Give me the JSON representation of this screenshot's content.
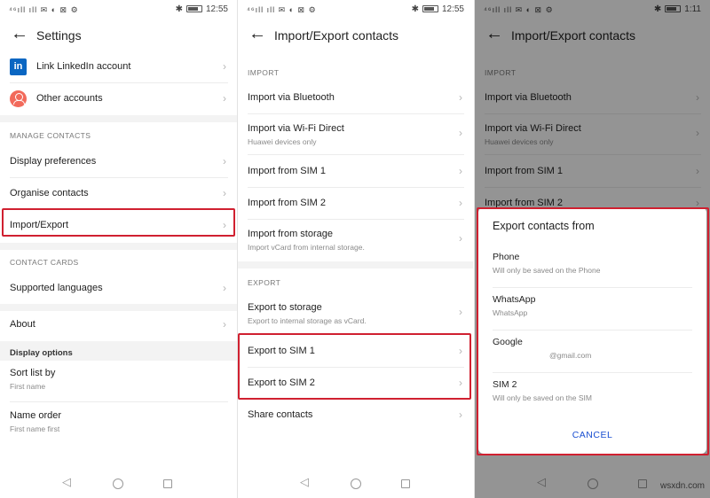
{
  "status": {
    "left_icons": "⁴⁶ıll ıll ✉ ◐ ⊠ ⚙",
    "time_left": "12:55",
    "time_middle": "12:55",
    "time_right": "1:11"
  },
  "screen1": {
    "title": "Settings",
    "accounts": [
      {
        "label": "Link LinkedIn account",
        "icon": "linkedin-icon"
      },
      {
        "label": "Other accounts",
        "icon": "account-icon"
      }
    ],
    "section_manage": "MANAGE CONTACTS",
    "manage_items": [
      "Display preferences",
      "Organise contacts",
      "Import/Export"
    ],
    "section_cards": "CONTACT CARDS",
    "card_items": [
      "Supported languages"
    ],
    "about": "About",
    "display_options": "Display options",
    "sort_list": {
      "title": "Sort list by",
      "sub": "First name"
    },
    "name_order": {
      "title": "Name order",
      "sub": "First name first"
    }
  },
  "screen2": {
    "title": "Import/Export contacts",
    "section_import": "IMPORT",
    "import_items": [
      {
        "title": "Import via Bluetooth",
        "sub": ""
      },
      {
        "title": "Import via Wi-Fi Direct",
        "sub": "Huawei devices only"
      },
      {
        "title": "Import from SIM 1",
        "sub": ""
      },
      {
        "title": "Import from SIM 2",
        "sub": ""
      },
      {
        "title": "Import from storage",
        "sub": "Import vCard from internal storage."
      }
    ],
    "section_export": "EXPORT",
    "export_items": [
      {
        "title": "Export to storage",
        "sub": "Export to internal storage as vCard."
      },
      {
        "title": "Export to SIM 1",
        "sub": ""
      },
      {
        "title": "Export to SIM 2",
        "sub": ""
      },
      {
        "title": "Share contacts",
        "sub": ""
      }
    ]
  },
  "screen3": {
    "title": "Import/Export contacts",
    "dialog": {
      "title": "Export contacts from",
      "options": [
        {
          "title": "Phone",
          "sub": "Will only be saved on the Phone"
        },
        {
          "title": "WhatsApp",
          "sub": "WhatsApp"
        },
        {
          "title": "Google",
          "sub": "@gmail.com"
        },
        {
          "title": "SIM 2",
          "sub": "Will only be saved on the SIM"
        }
      ],
      "cancel": "CANCEL"
    }
  },
  "watermark": "wsxdn.com",
  "colors": {
    "highlight": "#d02030",
    "accent": "#1a4fd1",
    "linkedin": "#0a66c2"
  }
}
